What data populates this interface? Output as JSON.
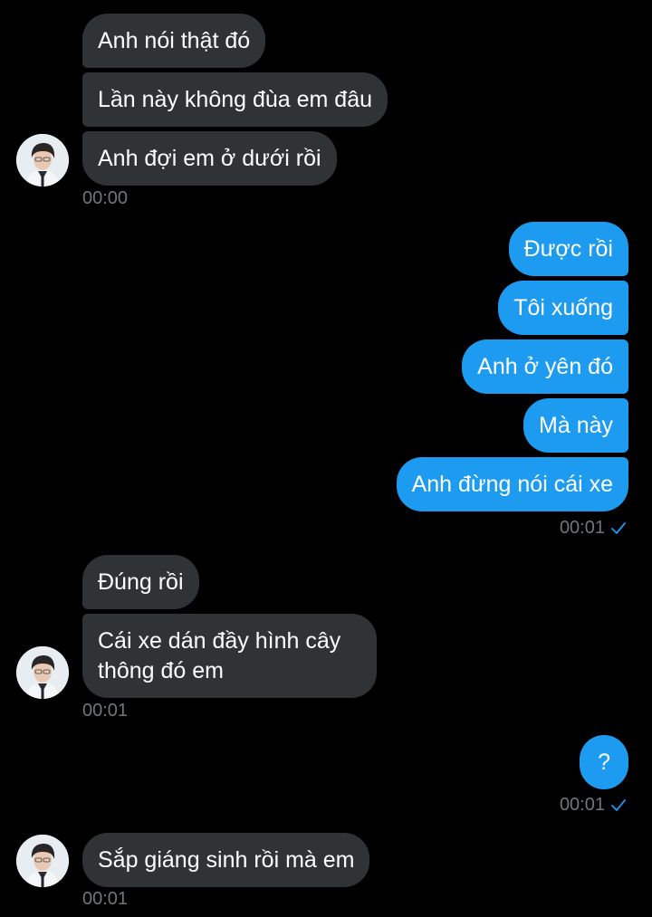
{
  "thread": [
    {
      "side": "in",
      "text": "Anh nói thật đó"
    },
    {
      "side": "in",
      "text": "Lần này không đùa em đâu"
    },
    {
      "side": "in",
      "text": "Anh đợi em ở dưới rồi"
    },
    {
      "side": "out",
      "text": "Được rồi"
    },
    {
      "side": "out",
      "text": "Tôi xuống"
    },
    {
      "side": "out",
      "text": "Anh ở yên đó"
    },
    {
      "side": "out",
      "text": "Mà này"
    },
    {
      "side": "out",
      "text": "Anh đừng nói cái xe"
    },
    {
      "side": "in",
      "text": "Đúng rồi"
    },
    {
      "side": "in",
      "text": "Cái xe dán đầy hình cây thông đó em"
    },
    {
      "side": "out",
      "text": "?"
    },
    {
      "side": "in",
      "text": "Sắp giáng sinh rồi mà em"
    }
  ],
  "timestamps": {
    "group1": "00:00",
    "group2": "00:01",
    "group3": "00:01",
    "group4": "00:01",
    "group5": "00:01"
  },
  "icons": {
    "read_receipt": "check-icon",
    "avatar": "avatar"
  },
  "colors": {
    "background": "#000000",
    "incoming_bubble": "#2f3336",
    "outgoing_bubble": "#1d9bf0",
    "timestamp": "#71767b",
    "check": "#1d9bf0"
  }
}
